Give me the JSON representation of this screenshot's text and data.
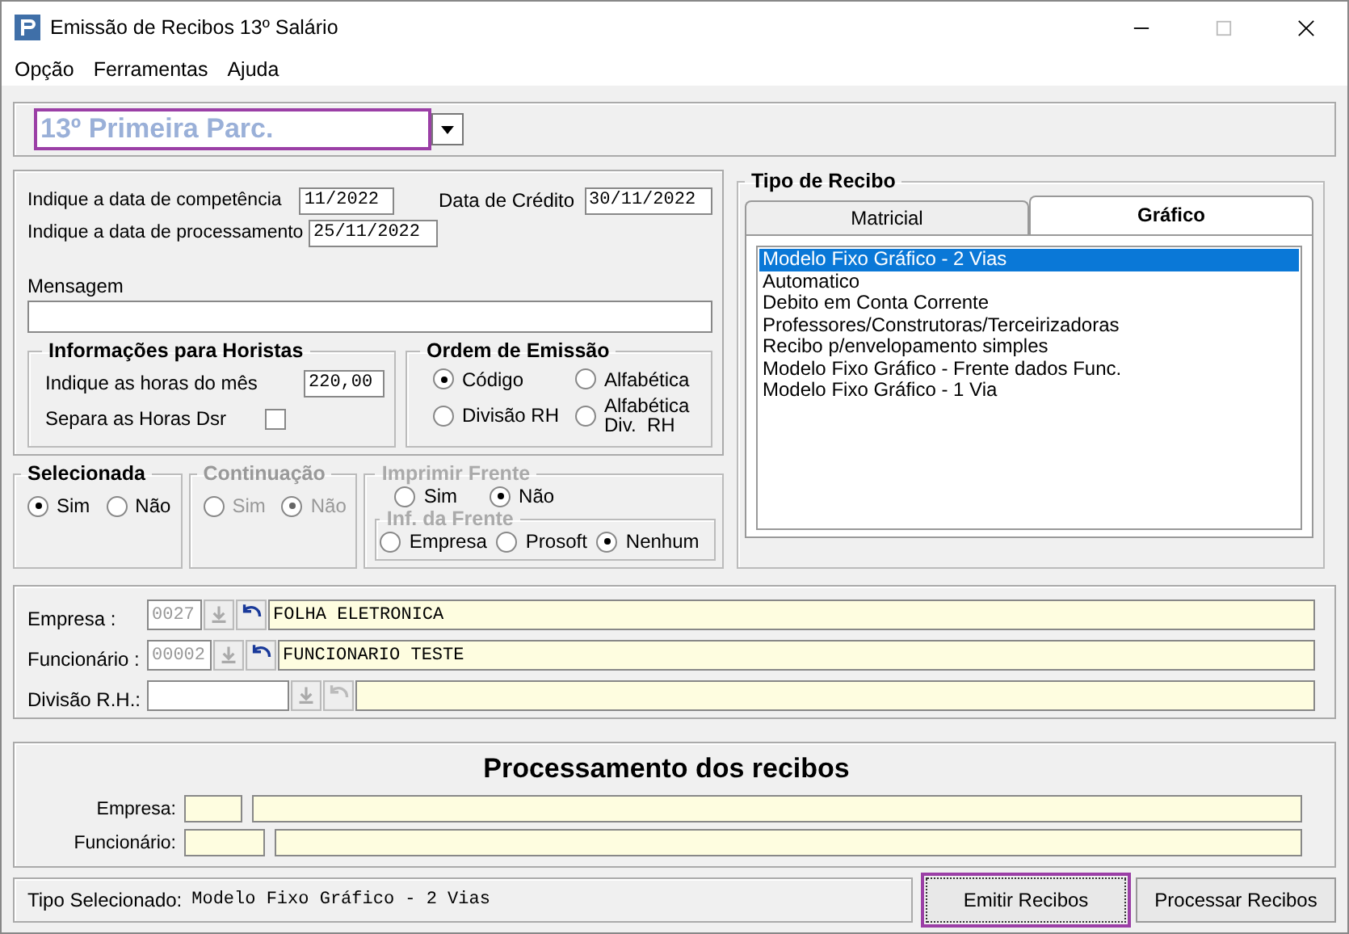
{
  "window": {
    "title": "Emissão de Recibos 13º Salário"
  },
  "menu": [
    "Opção",
    "Ferramentas",
    "Ajuda"
  ],
  "parcel_combo": {
    "value": "13º Primeira Parc."
  },
  "dates": {
    "competencia_label": "Indique a data de competência",
    "competencia": "11/2022",
    "credito_label": "Data de Crédito",
    "credito": "30/11/2022",
    "processamento_label": "Indique a data de processamento",
    "processamento": "25/11/2022"
  },
  "message": {
    "label": "Mensagem"
  },
  "horistas": {
    "title": "Informações para Horistas",
    "hours_label": "Indique as horas do mês",
    "hours": "220,00",
    "dsr_label": "Separa as Horas Dsr",
    "dsr_checked": false
  },
  "ordem": {
    "title": "Ordem de Emissão",
    "options": [
      {
        "label": "Código",
        "selected": true
      },
      {
        "label": "Alfabética",
        "selected": false
      },
      {
        "label": "Divisão RH",
        "selected": false
      },
      {
        "label": "Alfabética\nDiv.  RH",
        "selected": false
      }
    ]
  },
  "selecionada": {
    "title": "Selecionada",
    "disabled": false,
    "options": [
      {
        "label": "Sim",
        "selected": true
      },
      {
        "label": "Não",
        "selected": false
      }
    ]
  },
  "continuacao": {
    "title": "Continuação",
    "disabled": true,
    "options": [
      {
        "label": "Sim",
        "selected": false
      },
      {
        "label": "Não",
        "selected": true
      }
    ]
  },
  "imprimir_frente": {
    "title": "Imprimir Frente",
    "options": [
      {
        "label": "Sim",
        "selected": false
      },
      {
        "label": "Não",
        "selected": true
      }
    ],
    "inf_title": "Inf. da Frente",
    "inf_options": [
      {
        "label": "Empresa",
        "selected": false
      },
      {
        "label": "Prosoft",
        "selected": false
      },
      {
        "label": "Nenhum",
        "selected": true
      }
    ]
  },
  "tipo_recibo": {
    "title": "Tipo de Recibo",
    "tabs": [
      {
        "label": "Matricial",
        "selected": false
      },
      {
        "label": "Gráfico",
        "selected": true
      }
    ],
    "items": [
      {
        "label": "Modelo Fixo Gráfico - 2 Vias",
        "selected": true
      },
      {
        "label": "Automatico",
        "selected": false
      },
      {
        "label": "Debito em Conta Corrente",
        "selected": false
      },
      {
        "label": "Professores/Construtoras/Terceirizadoras",
        "selected": false
      },
      {
        "label": "Recibo p/envelopamento simples",
        "selected": false
      },
      {
        "label": "Modelo Fixo Gráfico - Frente dados Func.",
        "selected": false
      },
      {
        "label": "Modelo Fixo Gráfico - 1 Via",
        "selected": false
      }
    ]
  },
  "lookups": [
    {
      "label": "Empresa :",
      "code": "0027",
      "name": "FOLHA ELETRONICA",
      "disabled": false
    },
    {
      "label": "Funcionário :",
      "code": "00002",
      "name": "FUNCIONARIO TESTE",
      "disabled": false
    },
    {
      "label": "Divisão R.H.:",
      "disabled": true
    }
  ],
  "processamento": {
    "title": "Processamento dos recibos",
    "rows": [
      {
        "label": "Empresa:"
      },
      {
        "label": "Funcionário:"
      }
    ]
  },
  "status": {
    "label": "Tipo Selecionado:",
    "value": "Modelo Fixo Gráfico - 2 Vias"
  },
  "buttons": [
    {
      "label": "Emitir Recibos",
      "focused": true
    },
    {
      "label": "Processar Recibos",
      "focused": false
    }
  ]
}
